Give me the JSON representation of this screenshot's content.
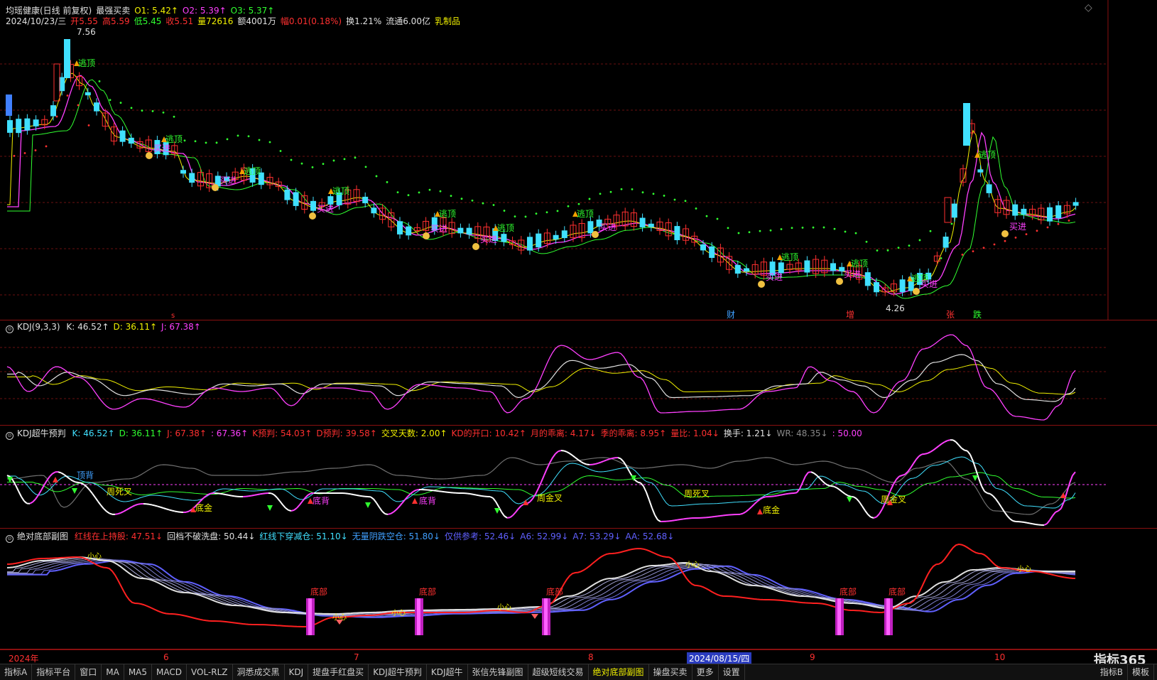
{
  "main_header": {
    "line1": [
      {
        "text": "均瑶健康(日线 前复权)",
        "color": "#e0e0e0"
      },
      {
        "text": "最强买卖",
        "color": "#e0e0e0"
      },
      {
        "text": "O1: 5.42↑",
        "color": "#f0f000"
      },
      {
        "text": "O2: 5.39↑",
        "color": "#ff40ff"
      },
      {
        "text": "O3: 5.37↑",
        "color": "#30ff30"
      }
    ],
    "line2": [
      {
        "text": "2024/10/23/三",
        "color": "#e0e0e0"
      },
      {
        "text": "开5.55",
        "color": "#ff3030"
      },
      {
        "text": "高5.59",
        "color": "#ff3030"
      },
      {
        "text": "低5.45",
        "color": "#30ff30"
      },
      {
        "text": "收5.51",
        "color": "#ff3030"
      },
      {
        "text": "量72616",
        "color": "#f0f000"
      },
      {
        "text": "额4001万",
        "color": "#e0e0e0"
      },
      {
        "text": "幅0.01(0.18%)",
        "color": "#ff3030"
      },
      {
        "text": "换1.21%",
        "color": "#e0e0e0"
      },
      {
        "text": "流通6.00亿",
        "color": "#e0e0e0"
      },
      {
        "text": "乳制品",
        "color": "#f0f000"
      }
    ],
    "price_high": "7.56",
    "price_low": "4.26"
  },
  "main_annotations": {
    "escape_top": "逃顶",
    "buy_in": "买进",
    "event_markers": [
      "财",
      "增",
      "张",
      "跌"
    ]
  },
  "kdj_panel": {
    "title": "KDJ(9,3,3)",
    "values": [
      {
        "text": "K: 46.52↑",
        "color": "#e0e0e0"
      },
      {
        "text": "D: 36.11↑",
        "color": "#f0f000"
      },
      {
        "text": "J: 67.38↑",
        "color": "#ff40ff"
      }
    ]
  },
  "kdj_super_panel": {
    "title": "KDJ超牛预判",
    "values": [
      {
        "text": "K: 46.52↑",
        "color": "#40e0ff"
      },
      {
        "text": "D: 36.11↑",
        "color": "#30ff30"
      },
      {
        "text": "J: 67.38↑",
        "color": "#ff3030"
      },
      {
        "text": ": 67.36↑",
        "color": "#ff40ff"
      },
      {
        "text": "K预判: 54.03↑",
        "color": "#ff3030"
      },
      {
        "text": "D预判: 39.58↑",
        "color": "#ff3030"
      },
      {
        "text": "交叉天数: 2.00↑",
        "color": "#f0f000"
      },
      {
        "text": "KD的开口: 10.42↑",
        "color": "#ff3030"
      },
      {
        "text": "月的乖离: 4.17↓",
        "color": "#ff3030"
      },
      {
        "text": "季的乖离: 8.95↑",
        "color": "#ff3030"
      },
      {
        "text": "量比: 1.04↓",
        "color": "#ff3030"
      },
      {
        "text": "换手: 1.21↓",
        "color": "#e0e0e0"
      },
      {
        "text": "WR: 48.35↓",
        "color": "#888888"
      },
      {
        "text": ": 50.00",
        "color": "#ff40ff"
      }
    ],
    "labels": {
      "top_div": "顶背",
      "week_dead": "周死叉",
      "bottom_gold": "底金",
      "bottom_div": "底背",
      "week_gold": "周金叉"
    }
  },
  "bottom_panel": {
    "title": "绝对底部副图",
    "values": [
      {
        "text": "红线在上持股: 47.51↓",
        "color": "#ff3030"
      },
      {
        "text": "回档不破洗盘: 50.44↓",
        "color": "#e0e0e0"
      },
      {
        "text": "红线下穿减仓: 51.10↓",
        "color": "#40e0ff"
      },
      {
        "text": "无量阴跌空仓: 51.80↓",
        "color": "#40a0ff"
      },
      {
        "text": "仅供参考: 52.46↓",
        "color": "#6060ff"
      },
      {
        "text": "A6: 52.99↓",
        "color": "#6060ff"
      },
      {
        "text": "A7: 53.29↓",
        "color": "#6060ff"
      },
      {
        "text": "AA: 52.68↓",
        "color": "#6060ff"
      }
    ],
    "bottom_label": "底部",
    "careful_label": "小心"
  },
  "time_axis": {
    "labels": [
      "2024年",
      "6",
      "7",
      "8",
      "2024/08/15/四",
      "9",
      "10"
    ]
  },
  "tabs": [
    "指标A",
    "指标平台",
    "窗口",
    "MA",
    "MA5",
    "MACD",
    "VOL-RLZ",
    "洞悉成交黑",
    "KDJ",
    "提盘手红盘买",
    "KDJ超牛预判",
    "KDJ超牛",
    "张信先锋副图",
    "超级短线交易",
    "绝对底部副图",
    "操盘买卖",
    "更多",
    "设置"
  ],
  "active_tab": "绝对底部副图",
  "right_tabs": [
    "指标B",
    "模板"
  ],
  "watermark": "指标365",
  "colors": {
    "up": "#ff3030",
    "down": "#40e0ff",
    "ma_yellow": "#f0f000",
    "ma_magenta": "#ff40ff",
    "ma_green": "#30ff30",
    "grid": "#8a1010"
  }
}
